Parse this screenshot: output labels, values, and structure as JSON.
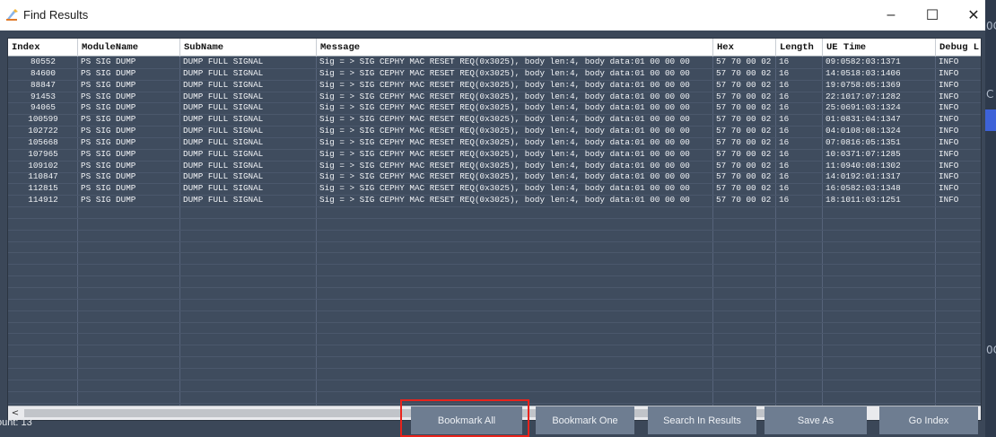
{
  "window": {
    "title": "Find  Results",
    "minimize_glyph": "–",
    "maximize_glyph": "☐",
    "close_glyph": "✕",
    "icon": "search-results-icon"
  },
  "background_window": {
    "glyph_1": "0C",
    "glyph_2": "C",
    "glyph_3": "0C"
  },
  "table": {
    "columns": [
      "Index",
      "ModuleName",
      "SubName",
      "Message",
      "Hex",
      "Length",
      "UE Time",
      "Debug L"
    ],
    "rows": [
      [
        "80552",
        "PS SIG DUMP",
        "DUMP FULL SIGNAL",
        "Sig = > SIG CEPHY MAC RESET REQ(0x3025), body len:4, body data:01 00 00 00",
        "57 70 00 02",
        "16",
        "09:0582:03:1371",
        "INFO"
      ],
      [
        "84600",
        "PS SIG DUMP",
        "DUMP FULL SIGNAL",
        "Sig = > SIG CEPHY MAC RESET REQ(0x3025), body len:4, body data:01 00 00 00",
        "57 70 00 02",
        "16",
        "14:0518:03:1406",
        "INFO"
      ],
      [
        "88847",
        "PS SIG DUMP",
        "DUMP FULL SIGNAL",
        "Sig = > SIG CEPHY MAC RESET REQ(0x3025), body len:4, body data:01 00 00 00",
        "57 70 00 02",
        "16",
        "19:0758:05:1369",
        "INFO"
      ],
      [
        "91453",
        "PS SIG DUMP",
        "DUMP FULL SIGNAL",
        "Sig = > SIG CEPHY MAC RESET REQ(0x3025), body len:4, body data:01 00 00 00",
        "57 70 00 02",
        "16",
        "22:1017:07:1282",
        "INFO"
      ],
      [
        "94065",
        "PS SIG DUMP",
        "DUMP FULL SIGNAL",
        "Sig = > SIG CEPHY MAC RESET REQ(0x3025), body len:4, body data:01 00 00 00",
        "57 70 00 02",
        "16",
        "25:0691:03:1324",
        "INFO"
      ],
      [
        "100599",
        "PS SIG DUMP",
        "DUMP FULL SIGNAL",
        "Sig = > SIG CEPHY MAC RESET REQ(0x3025), body len:4, body data:01 00 00 00",
        "57 70 00 02",
        "16",
        "01:0831:04:1347",
        "INFO"
      ],
      [
        "102722",
        "PS SIG DUMP",
        "DUMP FULL SIGNAL",
        "Sig = > SIG CEPHY MAC RESET REQ(0x3025), body len:4, body data:01 00 00 00",
        "57 70 00 02",
        "16",
        "04:0108:08:1324",
        "INFO"
      ],
      [
        "105668",
        "PS SIG DUMP",
        "DUMP FULL SIGNAL",
        "Sig = > SIG CEPHY MAC RESET REQ(0x3025), body len:4, body data:01 00 00 00",
        "57 70 00 02",
        "16",
        "07:0816:05:1351",
        "INFO"
      ],
      [
        "107965",
        "PS SIG DUMP",
        "DUMP FULL SIGNAL",
        "Sig = > SIG CEPHY MAC RESET REQ(0x3025), body len:4, body data:01 00 00 00",
        "57 70 00 02",
        "16",
        "10:0371:07:1285",
        "INFO"
      ],
      [
        "109102",
        "PS SIG DUMP",
        "DUMP FULL SIGNAL",
        "Sig = > SIG CEPHY MAC RESET REQ(0x3025), body len:4, body data:01 00 00 00",
        "57 70 00 02",
        "16",
        "11:0940:08:1302",
        "INFO"
      ],
      [
        "110847",
        "PS SIG DUMP",
        "DUMP FULL SIGNAL",
        "Sig = > SIG CEPHY MAC RESET REQ(0x3025), body len:4, body data:01 00 00 00",
        "57 70 00 02",
        "16",
        "14:0192:01:1317",
        "INFO"
      ],
      [
        "112815",
        "PS SIG DUMP",
        "DUMP FULL SIGNAL",
        "Sig = > SIG CEPHY MAC RESET REQ(0x3025), body len:4, body data:01 00 00 00",
        "57 70 00 02",
        "16",
        "16:0582:03:1348",
        "INFO"
      ],
      [
        "114912",
        "PS SIG DUMP",
        "DUMP FULL SIGNAL",
        "Sig = > SIG CEPHY MAC RESET REQ(0x3025), body len:4, body data:01 00 00 00",
        "57 70 00 02",
        "16",
        "18:1011:03:1251",
        "INFO"
      ]
    ]
  },
  "scrollbar": {
    "left_arrow": "<",
    "right_arrow": ">"
  },
  "footer": {
    "count_text": "ount: 13",
    "buttons": {
      "bookmark_all": "Bookmark All",
      "bookmark_one": "Bookmark One",
      "search_in_results": "Search In Results",
      "save_as": "Save As",
      "go_index": "Go Index"
    }
  },
  "colors": {
    "panel_bg": "#3b4758",
    "grid_bg": "#3f4c5e",
    "button_bg": "#6e7d91",
    "highlight_border": "#e8231c"
  }
}
